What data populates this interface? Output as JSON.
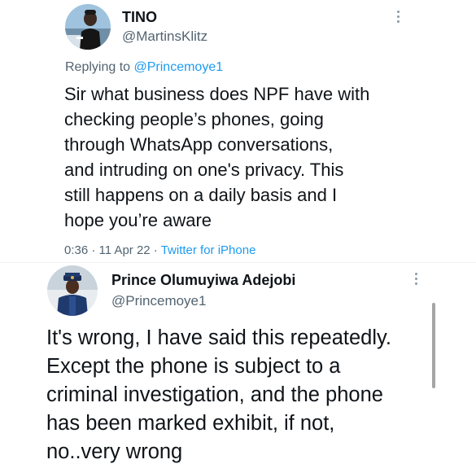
{
  "tweet1": {
    "display_name": "TINO",
    "handle": "@MartinsKlitz",
    "replying_prefix": "Replying to ",
    "replying_to": "@Princemoye1",
    "lines": [
      "Sir what business does NPF have with",
      "checking people’s phones, going",
      "through WhatsApp conversations,",
      "and intruding on one's privacy. This",
      "still happens on a daily basis and I",
      "hope you’re aware"
    ],
    "timestamp": "0:36 · 11 Apr 22 · ",
    "source": "Twitter for iPhone",
    "avatar_icon": "user-avatar-photo",
    "more_icon": "more-options-icon"
  },
  "tweet2": {
    "display_name": "Prince Olumuyiwa Adejobi",
    "handle": "@Princemoye1",
    "lines": [
      "It's wrong, I have said this repeatedly.",
      "Except the phone is subject to a",
      "criminal investigation, and the phone",
      "has been marked exhibit, if not,",
      "no..very wrong"
    ],
    "avatar_icon": "police-officer-avatar-photo",
    "more_icon": "more-options-icon"
  },
  "colors": {
    "text": "#0f1419",
    "secondary": "#536471",
    "link": "#1d9bf0",
    "background": "#ffffff"
  }
}
